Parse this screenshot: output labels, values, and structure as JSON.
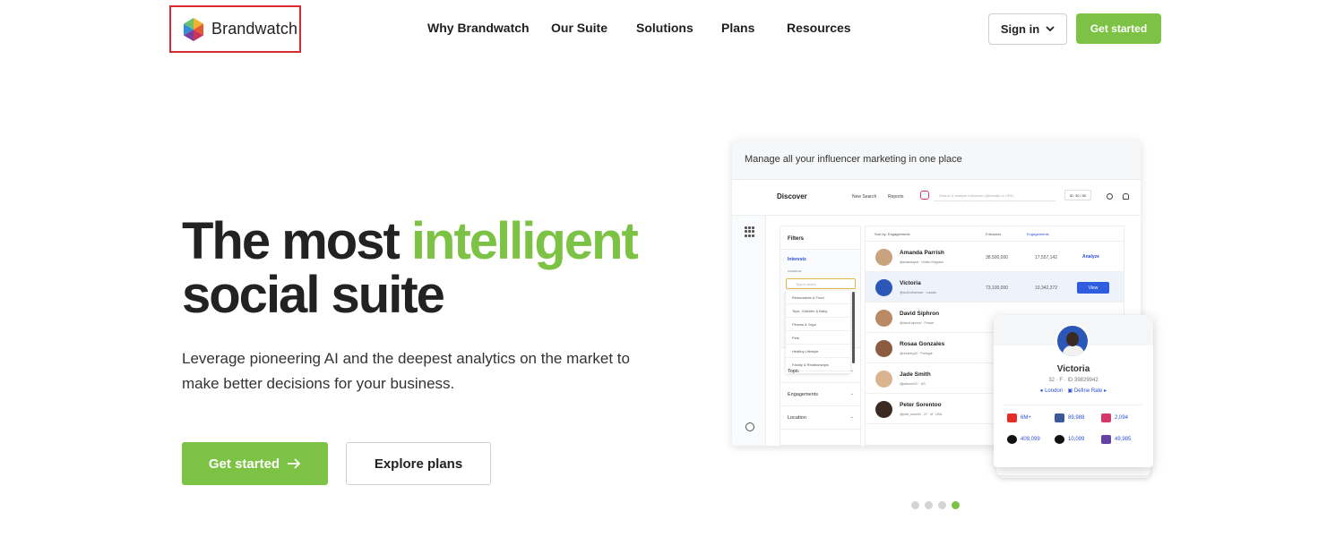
{
  "header": {
    "logo_text": "Brandwatch",
    "nav": [
      "Why Brandwatch",
      "Our Suite",
      "Solutions",
      "Plans",
      "Resources"
    ],
    "sign_in": "Sign in",
    "get_started": "Get started"
  },
  "hero": {
    "title_part1": "The most ",
    "title_highlight": "intelligent",
    "title_part2": "social suite",
    "subtitle": "Leverage pioneering AI and the deepest analytics on the market to make better decisions for your business.",
    "primary_button": "Get started",
    "secondary_button": "Explore plans"
  },
  "mockup": {
    "caption": "Manage all your influencer marketing in one place",
    "rail_logo": "In",
    "section": "Discover",
    "new_search": "New Search",
    "reports": "Reports",
    "search_placeholder": "Search & analyze influencer (@handle or URL)",
    "ids": "ID: 30 / 50",
    "filters": {
      "title": "Filters",
      "interests_label": "Interests",
      "audience_label": "AUDIENCE",
      "select_placeholder": "Type to search",
      "options": [
        "Restaurants & Food",
        "Toys, Children & Baby",
        "Fitness & Yoga",
        "Pets",
        "Healthy Lifestyle",
        "Family & Relationships"
      ],
      "rows": [
        "Topic",
        "Engagements",
        "Location"
      ]
    },
    "table": {
      "sort_label": "Sort by: Engagements",
      "col_followers": "Followers",
      "col_engagements": "Engagements",
      "rows": [
        {
          "name": "Amanda Parrish",
          "handle": "@amandapar  ·  United Kingdom",
          "followers": "38,500,000",
          "engagements": "17,557,142",
          "action": "Analyze",
          "avatar_color": "#c9a27e"
        },
        {
          "name": "Victoria",
          "handle": "@vicki.influencer  ·  London",
          "followers": "73,100,000",
          "engagements": "10,342,372",
          "action": "View",
          "avatar_color": "#2b58b8"
        },
        {
          "name": "David Siphron",
          "handle": "@david.siphron  ·  France",
          "followers": "",
          "engagements": "",
          "action": "",
          "avatar_color": "#b98a63"
        },
        {
          "name": "Rosaa Gonzales",
          "handle": "@rlonberg10  ·  Portugal",
          "followers": "",
          "engagements": "",
          "action": "",
          "avatar_color": "#8d5b3f"
        },
        {
          "name": "Jade Smith",
          "handle": "@jadesm107  ·  US",
          "followers": "",
          "engagements": "",
          "action": "",
          "avatar_color": "#d9b48f"
        },
        {
          "name": "Peter Sorentoo",
          "handle": "@pete_sorent1  ·  27  ·  M  ·  USA",
          "followers": "",
          "engagements": "",
          "action": "",
          "avatar_color": "#3a2a22"
        }
      ]
    }
  },
  "profile_card": {
    "name": "Victoria",
    "meta": "32  ·  F  ·  ID 39829942",
    "location": "London",
    "rate": "Define Rate",
    "stats": [
      {
        "icon": "youtube-icon",
        "value": "6M+",
        "color": "#e52d27"
      },
      {
        "icon": "facebook-icon",
        "value": "89,988",
        "color": "#3b5998"
      },
      {
        "icon": "instagram-icon",
        "value": "2,094",
        "color": "#d6376d"
      },
      {
        "icon": "x-icon",
        "value": "409,099",
        "color": "#111111"
      },
      {
        "icon": "tiktok-icon",
        "value": "10,099",
        "color": "#111111"
      },
      {
        "icon": "twitch-icon",
        "value": "49,985",
        "color": "#6441a5"
      }
    ]
  },
  "carousel": {
    "total": 4,
    "active_index": 3
  },
  "colors": {
    "accent": "#7cc244",
    "link": "#2b4fd6"
  }
}
